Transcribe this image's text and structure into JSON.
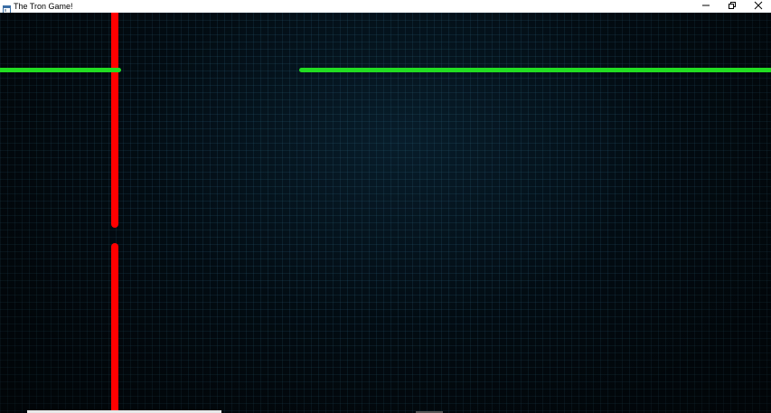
{
  "window": {
    "title": "The Tron Game!",
    "icon": "app-window-icon",
    "controls": {
      "minimize_icon": "minimize-icon",
      "restore_icon": "restore-icon",
      "close_icon": "close-icon"
    }
  },
  "game": {
    "players": [
      {
        "color": "#ff0000",
        "trail": "vertical"
      },
      {
        "color": "#22dd22",
        "trail": "horizontal"
      }
    ],
    "background_color": "#020a10",
    "grid_color": "#285a73"
  }
}
